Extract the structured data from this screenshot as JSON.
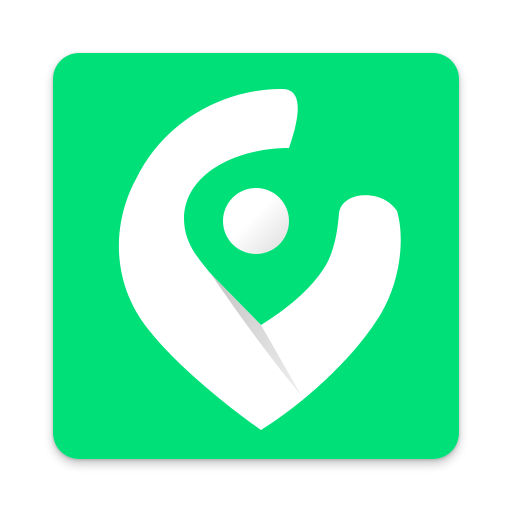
{
  "icon": {
    "name": "location-pin-logo",
    "colors": {
      "background": "#00E078",
      "glyph": "#FFFFFF",
      "shade": "#D3D3D3"
    }
  }
}
